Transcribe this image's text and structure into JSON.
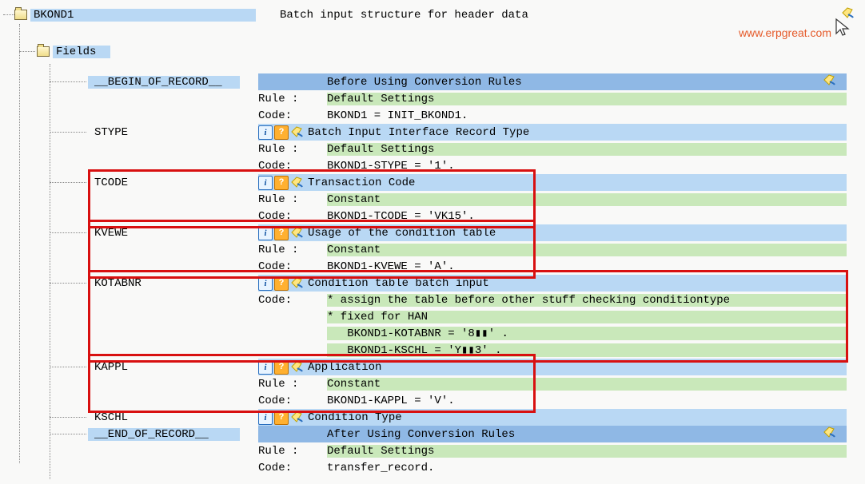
{
  "watermark": "www.erpgreat.com",
  "root": {
    "name": "BKOND1",
    "desc": "Batch input structure for header data"
  },
  "fieldsLabel": "Fields",
  "fields": {
    "begin": {
      "name": "__BEGIN_OF_RECORD__",
      "desc": "Before Using Conversion Rules",
      "ruleLabel": "Rule :",
      "rule": "Default Settings",
      "codeLabel": "Code:",
      "code": "BKOND1 = INIT_BKOND1."
    },
    "stype": {
      "name": "STYPE",
      "desc": "Batch Input Interface Record Type",
      "ruleLabel": "Rule :",
      "rule": "Default Settings",
      "codeLabel": "Code:",
      "code": "BKOND1-STYPE = '1'."
    },
    "tcode": {
      "name": "TCODE",
      "desc": "Transaction Code",
      "ruleLabel": "Rule :",
      "rule": "Constant",
      "codeLabel": "Code:",
      "code": "BKOND1-TCODE = 'VK15'."
    },
    "kvewe": {
      "name": "KVEWE",
      "desc": "Usage of the condition table",
      "ruleLabel": "Rule :",
      "rule": "Constant",
      "codeLabel": "Code:",
      "code": "BKOND1-KVEWE = 'A'."
    },
    "kotabnr": {
      "name": "KOTABNR",
      "desc": "Condition table batch input",
      "codeLabel": "Code:",
      "l1": "* assign the table before other stuff checking conditiontype",
      "l2": "* fixed for HAN",
      "l3": "   BKOND1-KOTABNR = '8▮▮' .",
      "l4": "   BKOND1-KSCHL = 'Y▮▮3' ."
    },
    "kappl": {
      "name": "KAPPL",
      "desc": "Application",
      "ruleLabel": "Rule :",
      "rule": "Constant",
      "codeLabel": "Code:",
      "code": "BKOND1-KAPPL = 'V'."
    },
    "kschl": {
      "name": "KSCHL",
      "desc": "Condition Type"
    },
    "end": {
      "name": "__END_OF_RECORD__",
      "desc": "After Using Conversion Rules",
      "ruleLabel": "Rule :",
      "rule": "Default Settings",
      "codeLabel": "Code:",
      "code": "transfer_record."
    }
  }
}
